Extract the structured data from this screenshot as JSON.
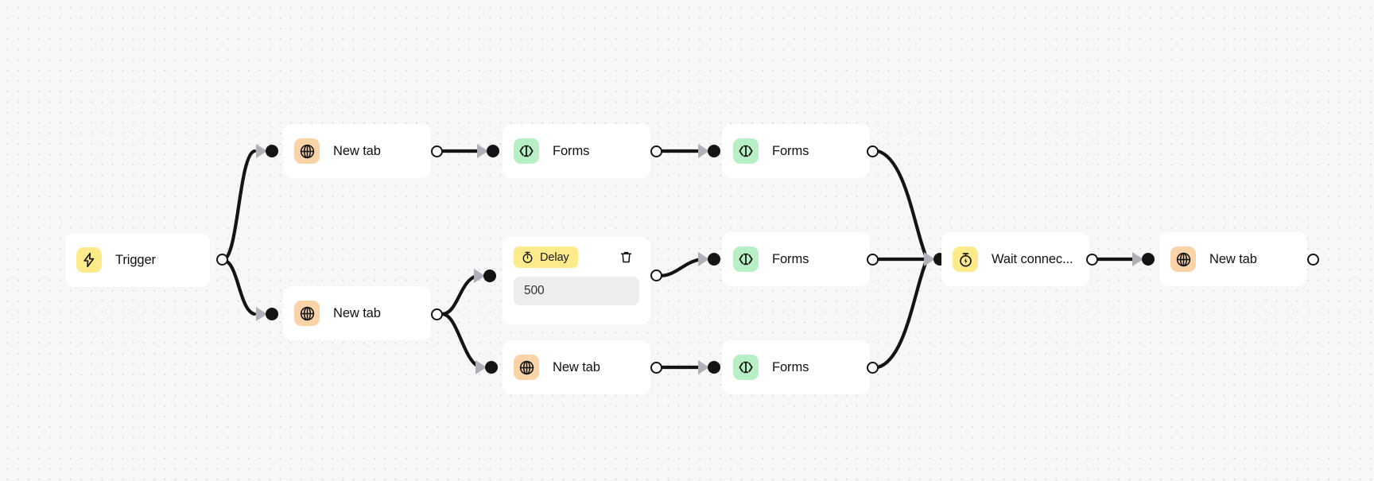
{
  "canvas": {
    "background_color": "#f7f7f7",
    "dot_color": "#d9d9d9",
    "edge_color": "#141414"
  },
  "palette": {
    "trigger_yellow": "#FCEA8B",
    "newtab_peach": "#FBD3A8",
    "forms_green": "#B6F0C4",
    "input_gray": "#ededed",
    "port_arrow_gray": "#b0b0b8",
    "node_white": "#ffffff"
  },
  "nodes": [
    {
      "id": "trigger",
      "label": "Trigger",
      "icon": "lightning-bolt-icon",
      "icon_color": "trigger_yellow"
    },
    {
      "id": "newtab1",
      "label": "New tab",
      "icon": "globe-icon",
      "icon_color": "newtab_peach"
    },
    {
      "id": "forms1",
      "label": "Forms",
      "icon": "forms-code-icon",
      "icon_color": "forms_green"
    },
    {
      "id": "forms2",
      "label": "Forms",
      "icon": "forms-code-icon",
      "icon_color": "forms_green"
    },
    {
      "id": "newtab2",
      "label": "New tab",
      "icon": "globe-icon",
      "icon_color": "newtab_peach"
    },
    {
      "id": "forms3",
      "label": "Forms",
      "icon": "forms-code-icon",
      "icon_color": "forms_green"
    },
    {
      "id": "newtab3",
      "label": "New tab",
      "icon": "globe-icon",
      "icon_color": "newtab_peach"
    },
    {
      "id": "forms4",
      "label": "Forms",
      "icon": "forms-code-icon",
      "icon_color": "forms_green"
    },
    {
      "id": "wait",
      "label": "Wait connec...",
      "icon": "stopwatch-bolt-icon",
      "icon_color": "trigger_yellow"
    },
    {
      "id": "newtab4",
      "label": "New tab",
      "icon": "globe-icon",
      "icon_color": "newtab_peach"
    }
  ],
  "delay_node": {
    "badge_label": "Delay",
    "badge_icon": "stopwatch-icon",
    "delete_icon": "trash-icon",
    "value": "500",
    "placeholder": "500"
  }
}
